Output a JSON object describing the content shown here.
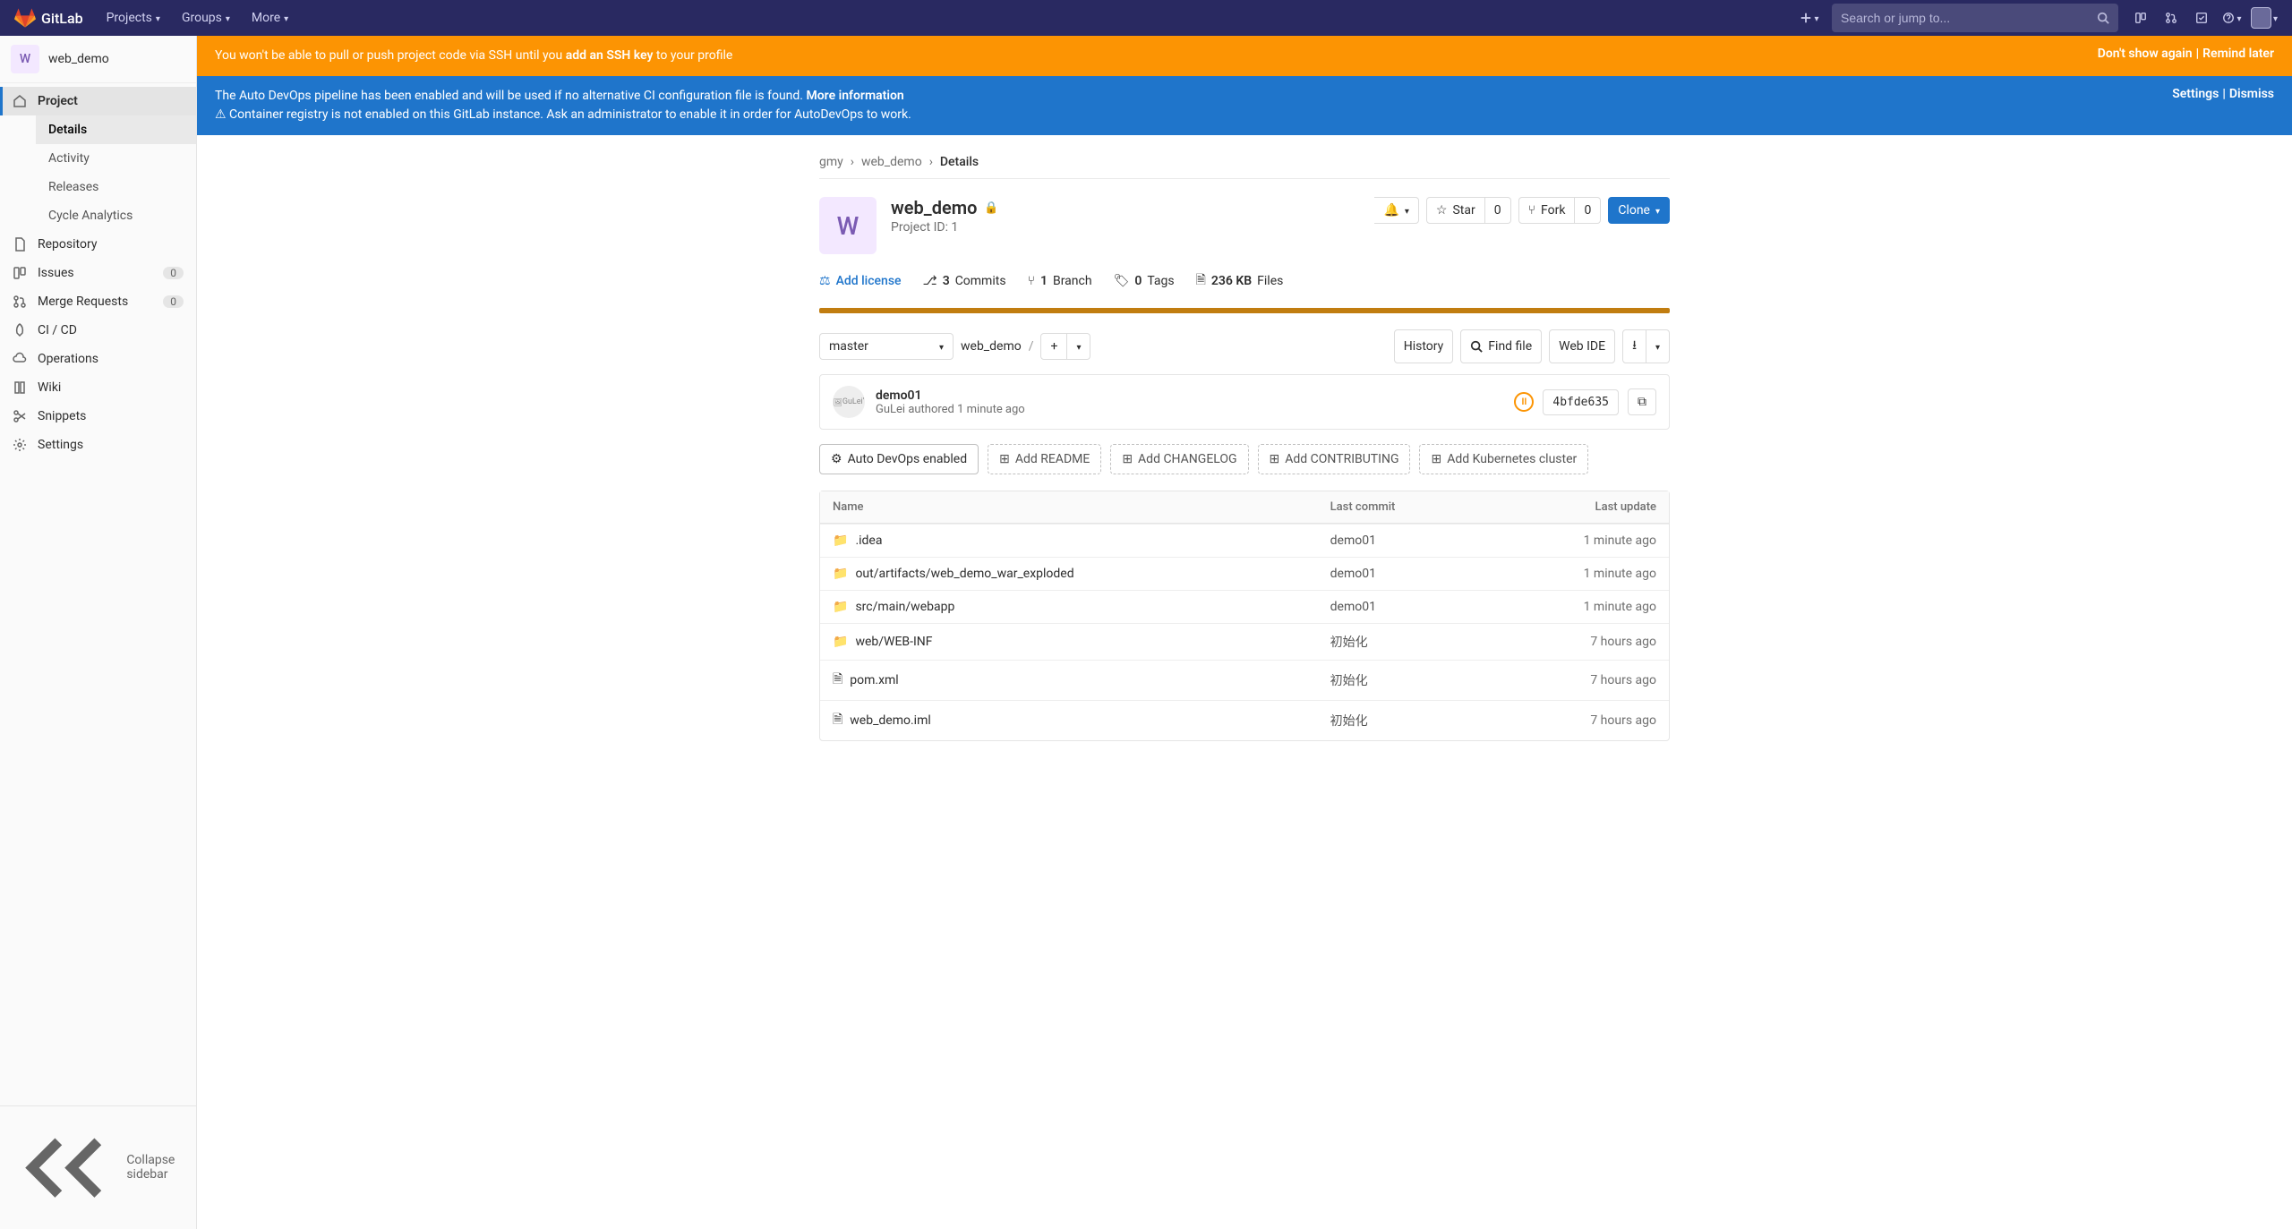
{
  "topbar": {
    "brand": "GitLab",
    "nav": [
      "Projects",
      "Groups",
      "More"
    ],
    "search_placeholder": "Search or jump to..."
  },
  "sidebar": {
    "context_letter": "W",
    "context_name": "web_demo",
    "items": [
      {
        "label": "Project",
        "icon": "home",
        "active": true,
        "sub": [
          {
            "label": "Details",
            "active": true
          },
          {
            "label": "Activity"
          },
          {
            "label": "Releases"
          },
          {
            "label": "Cycle Analytics"
          }
        ]
      },
      {
        "label": "Repository",
        "icon": "doc"
      },
      {
        "label": "Issues",
        "icon": "issues",
        "badge": "0"
      },
      {
        "label": "Merge Requests",
        "icon": "merge",
        "badge": "0"
      },
      {
        "label": "CI / CD",
        "icon": "rocket"
      },
      {
        "label": "Operations",
        "icon": "cloud"
      },
      {
        "label": "Wiki",
        "icon": "book"
      },
      {
        "label": "Snippets",
        "icon": "scissors"
      },
      {
        "label": "Settings",
        "icon": "gear"
      }
    ],
    "collapse": "Collapse sidebar"
  },
  "banners": {
    "ssh": {
      "pre": "You won't be able to pull or push project code via SSH until you ",
      "link": "add an SSH key",
      "post": " to your profile",
      "act1": "Don't show again",
      "act2": "Remind later"
    },
    "devops": {
      "line1_pre": "The Auto DevOps pipeline has been enabled and will be used if no alternative CI configuration file is found. ",
      "line1_link": "More information",
      "line2": "Container registry is not enabled on this GitLab instance. Ask an administrator to enable it in order for AutoDevOps to work.",
      "act1": "Settings",
      "act2": "Dismiss"
    }
  },
  "breadcrumb": [
    "gmy",
    "web_demo",
    "Details"
  ],
  "project": {
    "letter": "W",
    "name": "web_demo",
    "pid": "Project ID: 1",
    "notify": "",
    "star_label": "Star",
    "star_count": "0",
    "fork_label": "Fork",
    "fork_count": "0",
    "clone": "Clone"
  },
  "stats": {
    "license": "Add license",
    "commits_n": "3",
    "commits_l": "Commits",
    "branch_n": "1",
    "branch_l": "Branch",
    "tags_n": "0",
    "tags_l": "Tags",
    "size_n": "236 KB",
    "size_l": "Files"
  },
  "tree": {
    "branch": "master",
    "path": "web_demo",
    "history": "History",
    "find": "Find file",
    "webide": "Web IDE"
  },
  "commit": {
    "title": "demo01",
    "avatar_alt": "GuLei'",
    "author": "GuLei",
    "authored": "authored",
    "when": "1 minute ago",
    "pipeline": "II",
    "sha": "4bfde635"
  },
  "setup": {
    "auto": "Auto DevOps enabled",
    "readme": "Add README",
    "changelog": "Add CHANGELOG",
    "contrib": "Add CONTRIBUTING",
    "kube": "Add Kubernetes cluster"
  },
  "filetable": {
    "headers": {
      "name": "Name",
      "commit": "Last commit",
      "update": "Last update"
    },
    "rows": [
      {
        "icon": "folder",
        "name": ".idea",
        "commit": "demo01",
        "update": "1 minute ago"
      },
      {
        "icon": "folder",
        "name": "out/artifacts/web_demo_war_exploded",
        "commit": "demo01",
        "update": "1 minute ago"
      },
      {
        "icon": "folder",
        "name": "src/main/webapp",
        "commit": "demo01",
        "update": "1 minute ago"
      },
      {
        "icon": "folder",
        "name": "web/WEB-INF",
        "commit": "初始化",
        "update": "7 hours ago"
      },
      {
        "icon": "file",
        "name": "pom.xml",
        "commit": "初始化",
        "update": "7 hours ago"
      },
      {
        "icon": "file",
        "name": "web_demo.iml",
        "commit": "初始化",
        "update": "7 hours ago"
      }
    ]
  }
}
